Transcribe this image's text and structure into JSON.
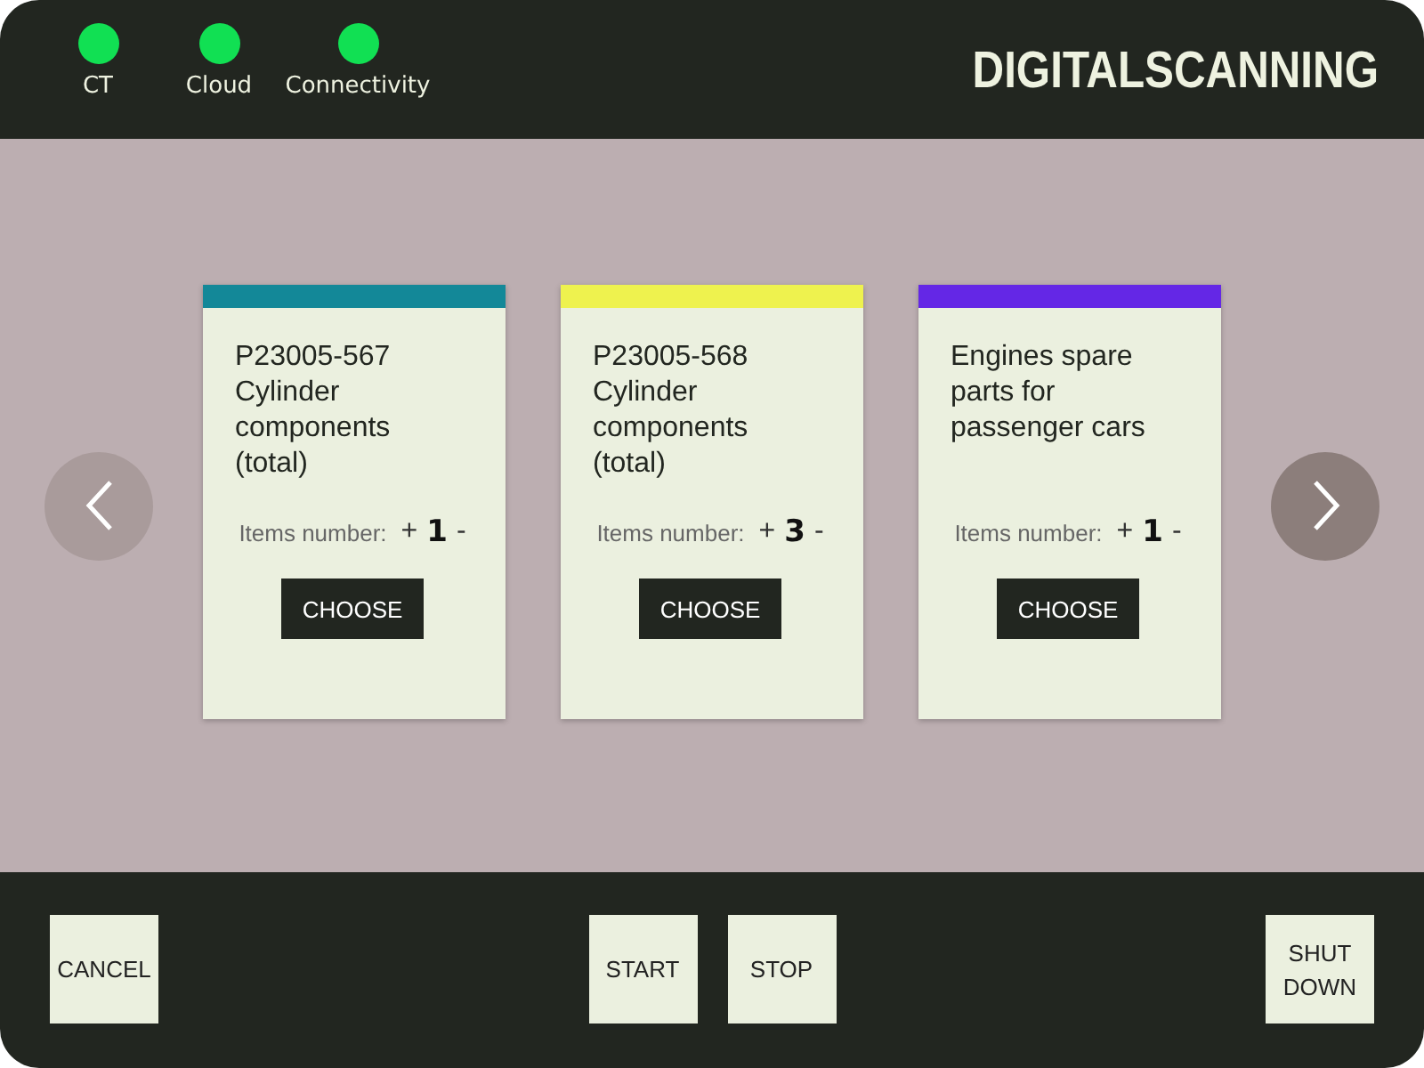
{
  "status_indicators": [
    {
      "label": "CT",
      "on": true
    },
    {
      "label": "Cloud",
      "on": true
    },
    {
      "label": "Connectivity",
      "on": true
    }
  ],
  "brand": "DIGITALSCANNING",
  "cards": [
    {
      "title": "P23005-567 Cylinder components (total)",
      "color": "#138898",
      "items_label": "Items number:",
      "plus": "+",
      "count": "1",
      "minus": "-",
      "button": "CHOOSE"
    },
    {
      "title": "P23005-568 Cylinder components (total)",
      "color": "#eef24e",
      "items_label": "Items number:",
      "plus": "+",
      "count": "3",
      "minus": "-",
      "button": "CHOOSE"
    },
    {
      "title": "Engines spare parts for passenger cars",
      "color": "#6427e6",
      "items_label": "Items number:",
      "plus": "+",
      "count": "1",
      "minus": "-",
      "button": "CHOOSE"
    }
  ],
  "footer": {
    "left": [
      "CANCEL"
    ],
    "center": [
      "START",
      "STOP"
    ],
    "right": [
      "SHUT DOWN"
    ]
  }
}
